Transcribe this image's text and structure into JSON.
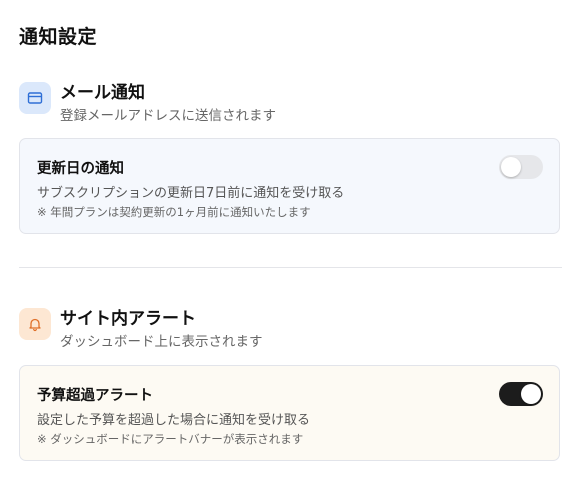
{
  "page": {
    "title": "通知設定"
  },
  "sections": [
    {
      "icon": "credit-card-icon",
      "icon_bg": "#dbe8fb",
      "icon_color": "#2f6fd6",
      "title": "メール通知",
      "subtitle": "登録メールアドレスに送信されます",
      "setting": {
        "title": "更新日の通知",
        "description": "サブスクリプションの更新日7日前に通知を受け取る",
        "note": "※ 年間プランは契約更新の1ヶ月前に通知いたします",
        "enabled": false
      }
    },
    {
      "icon": "bell-icon",
      "icon_bg": "#fde7d3",
      "icon_color": "#e0702a",
      "title": "サイト内アラート",
      "subtitle": "ダッシュボード上に表示されます",
      "setting": {
        "title": "予算超過アラート",
        "description": "設定した予算を超過した場合に通知を受け取る",
        "note": "※ ダッシュボードにアラートバナーが表示されます",
        "enabled": true
      }
    }
  ]
}
